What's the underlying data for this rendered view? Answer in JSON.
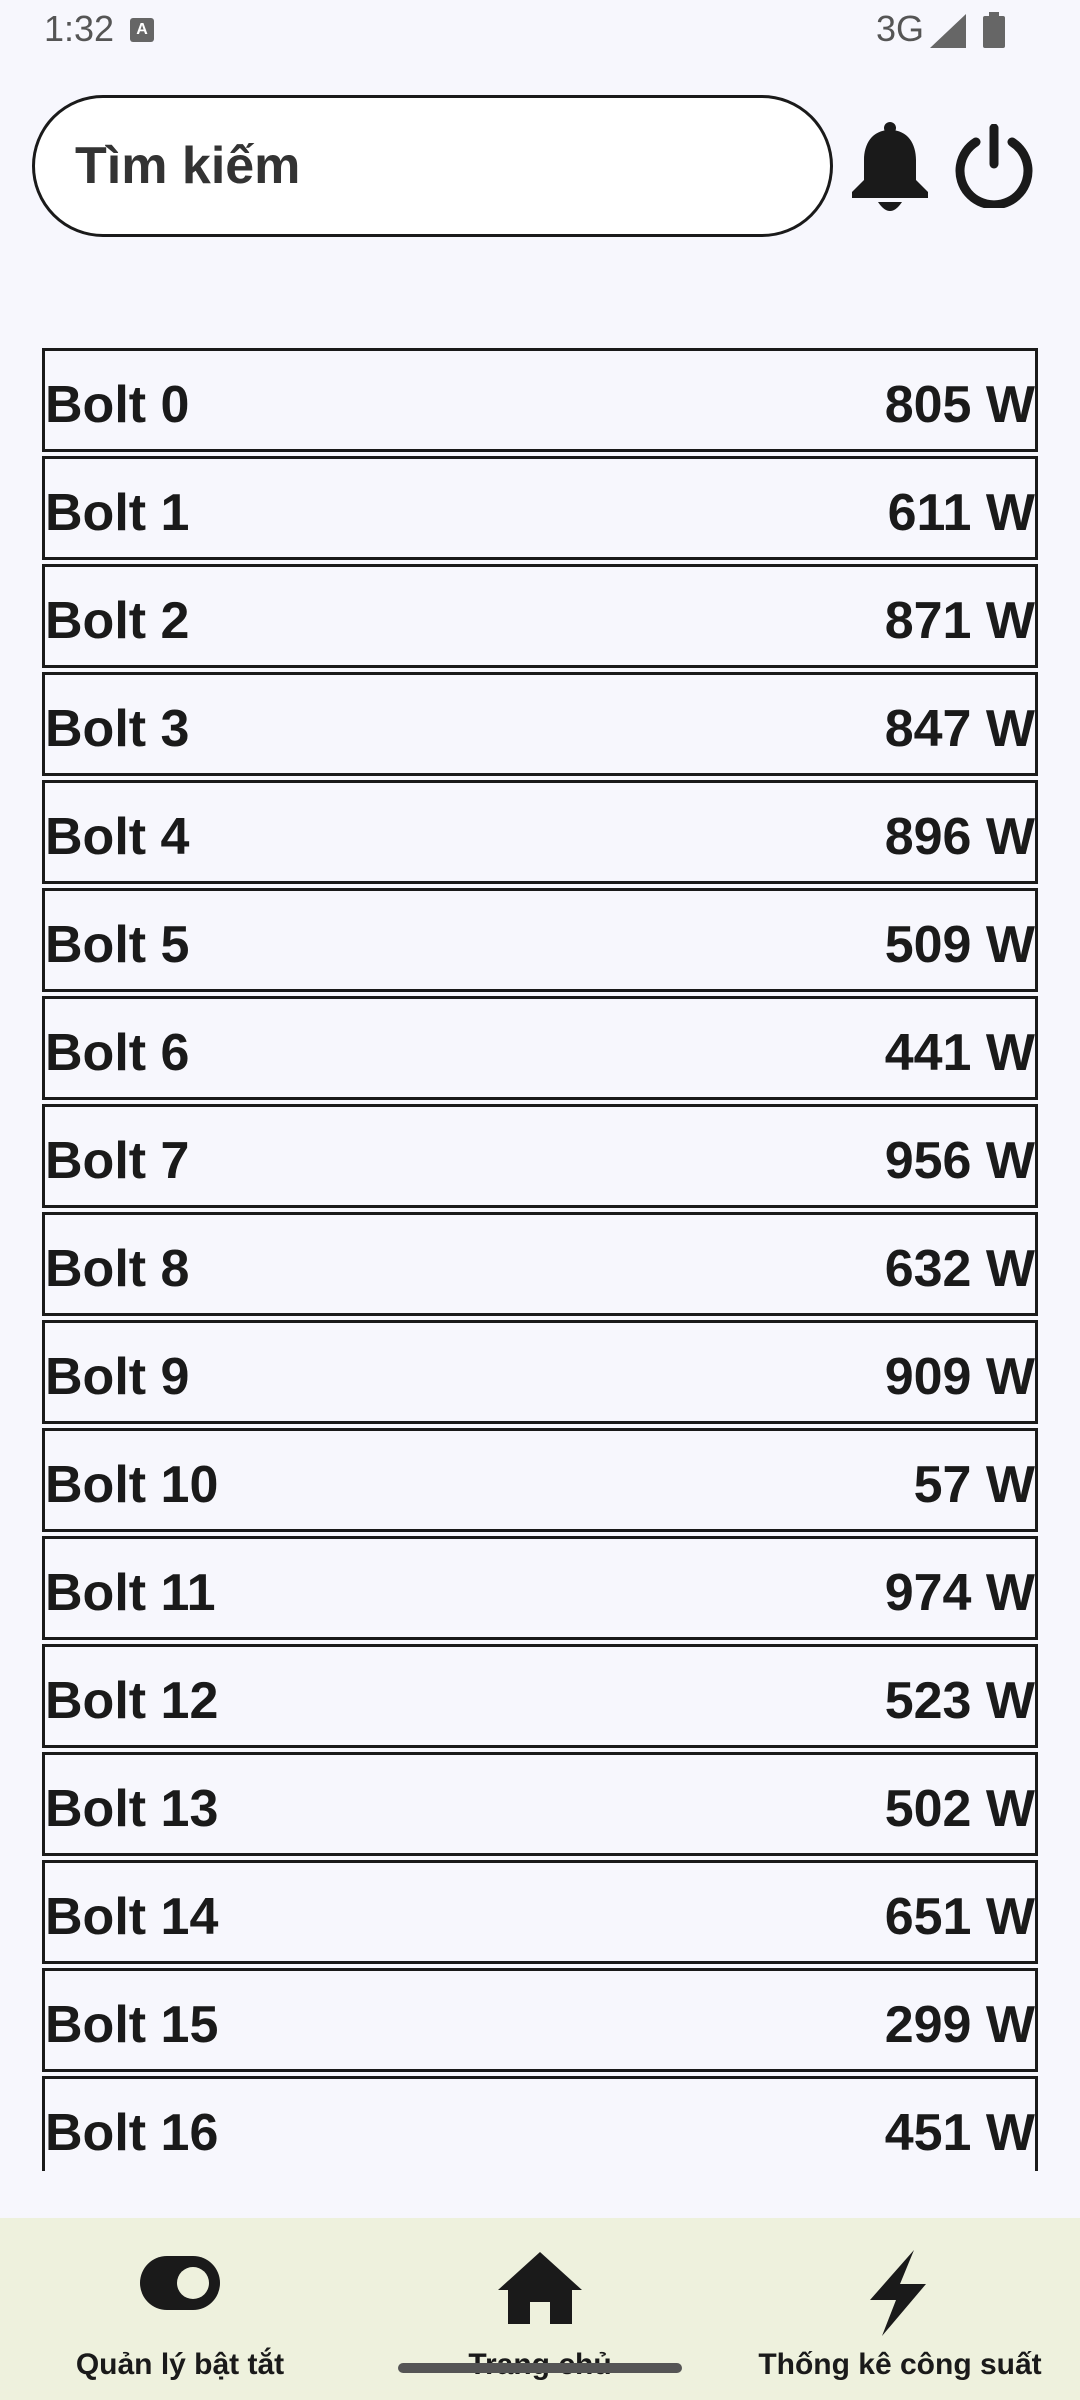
{
  "status_bar": {
    "time": "1:32",
    "network": "3G",
    "notification_icon": "a-icon",
    "signal_icon": "signal-icon",
    "battery_icon": "battery-icon"
  },
  "header": {
    "search_placeholder": "Tìm kiếm",
    "bell_icon": "bell-icon",
    "power_icon": "power-icon"
  },
  "list": {
    "items": [
      {
        "name": "Bolt 0",
        "value": "805 W"
      },
      {
        "name": "Bolt 1",
        "value": "611 W"
      },
      {
        "name": "Bolt 2",
        "value": "871 W"
      },
      {
        "name": "Bolt 3",
        "value": "847 W"
      },
      {
        "name": "Bolt 4",
        "value": "896 W"
      },
      {
        "name": "Bolt 5",
        "value": "509 W"
      },
      {
        "name": "Bolt 6",
        "value": "441 W"
      },
      {
        "name": "Bolt 7",
        "value": "956 W"
      },
      {
        "name": "Bolt 8",
        "value": "632 W"
      },
      {
        "name": "Bolt 9",
        "value": "909 W"
      },
      {
        "name": "Bolt 10",
        "value": "57 W"
      },
      {
        "name": "Bolt 11",
        "value": "974 W"
      },
      {
        "name": "Bolt 12",
        "value": "523 W"
      },
      {
        "name": "Bolt 13",
        "value": "502 W"
      },
      {
        "name": "Bolt 14",
        "value": "651 W"
      },
      {
        "name": "Bolt 15",
        "value": "299 W"
      },
      {
        "name": "Bolt 16",
        "value": "451 W"
      }
    ]
  },
  "bottom_nav": {
    "items": [
      {
        "label": "Quản lý bật tắt",
        "icon": "toggle-icon"
      },
      {
        "label": "Trang chủ",
        "icon": "home-icon"
      },
      {
        "label": "Thống kê công suất",
        "icon": "lightning-icon"
      }
    ]
  }
}
